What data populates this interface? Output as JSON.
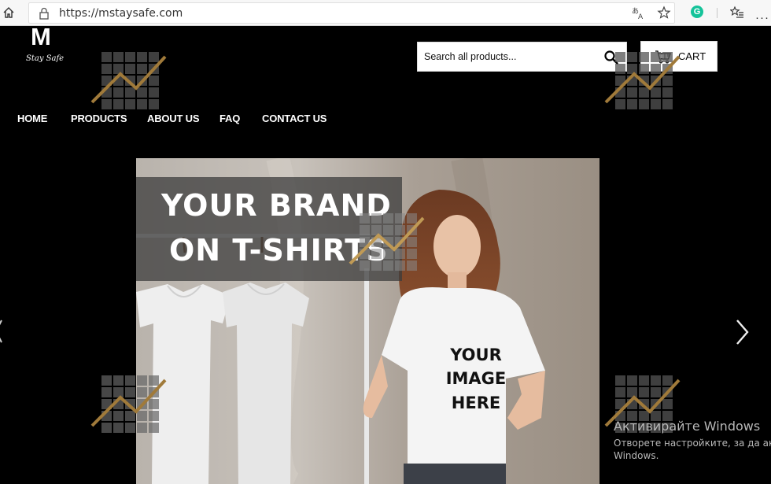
{
  "browser": {
    "url": "https://mstaysafe.com",
    "grammarly_letter": "G",
    "more_label": "···"
  },
  "logo": {
    "letter": "M",
    "tagline": "Stay Safe"
  },
  "search": {
    "placeholder": "Search all products..."
  },
  "cart": {
    "label": "CART"
  },
  "nav": {
    "items": [
      {
        "label": "HOME"
      },
      {
        "label": "PRODUCTS"
      },
      {
        "label": "ABOUT US"
      },
      {
        "label": "FAQ"
      },
      {
        "label": "CONTACT US"
      }
    ]
  },
  "hero": {
    "line1": "YOUR BRAND",
    "line2": "ON T-SHIRTS",
    "shirt_lines": [
      "YOUR",
      "IMAGE",
      "HERE"
    ]
  },
  "os_overlay": {
    "title": "Активирайте Windows",
    "line1": "Отворете настройките, за да акти",
    "line2": "Windows."
  },
  "icons": {
    "home": "home-icon",
    "lock": "lock-icon",
    "translate": "translate-icon",
    "favorite": "star-icon",
    "favorites_bar": "favorites-icon",
    "search": "search-icon",
    "cart": "cart-icon",
    "prev": "chevron-left-icon",
    "next": "chevron-right-icon",
    "watermark": "watermark-chart-icon"
  },
  "colors": {
    "page_bg": "#000000",
    "grammarly": "#15c39a",
    "watermark_line": "#a07a3a"
  }
}
